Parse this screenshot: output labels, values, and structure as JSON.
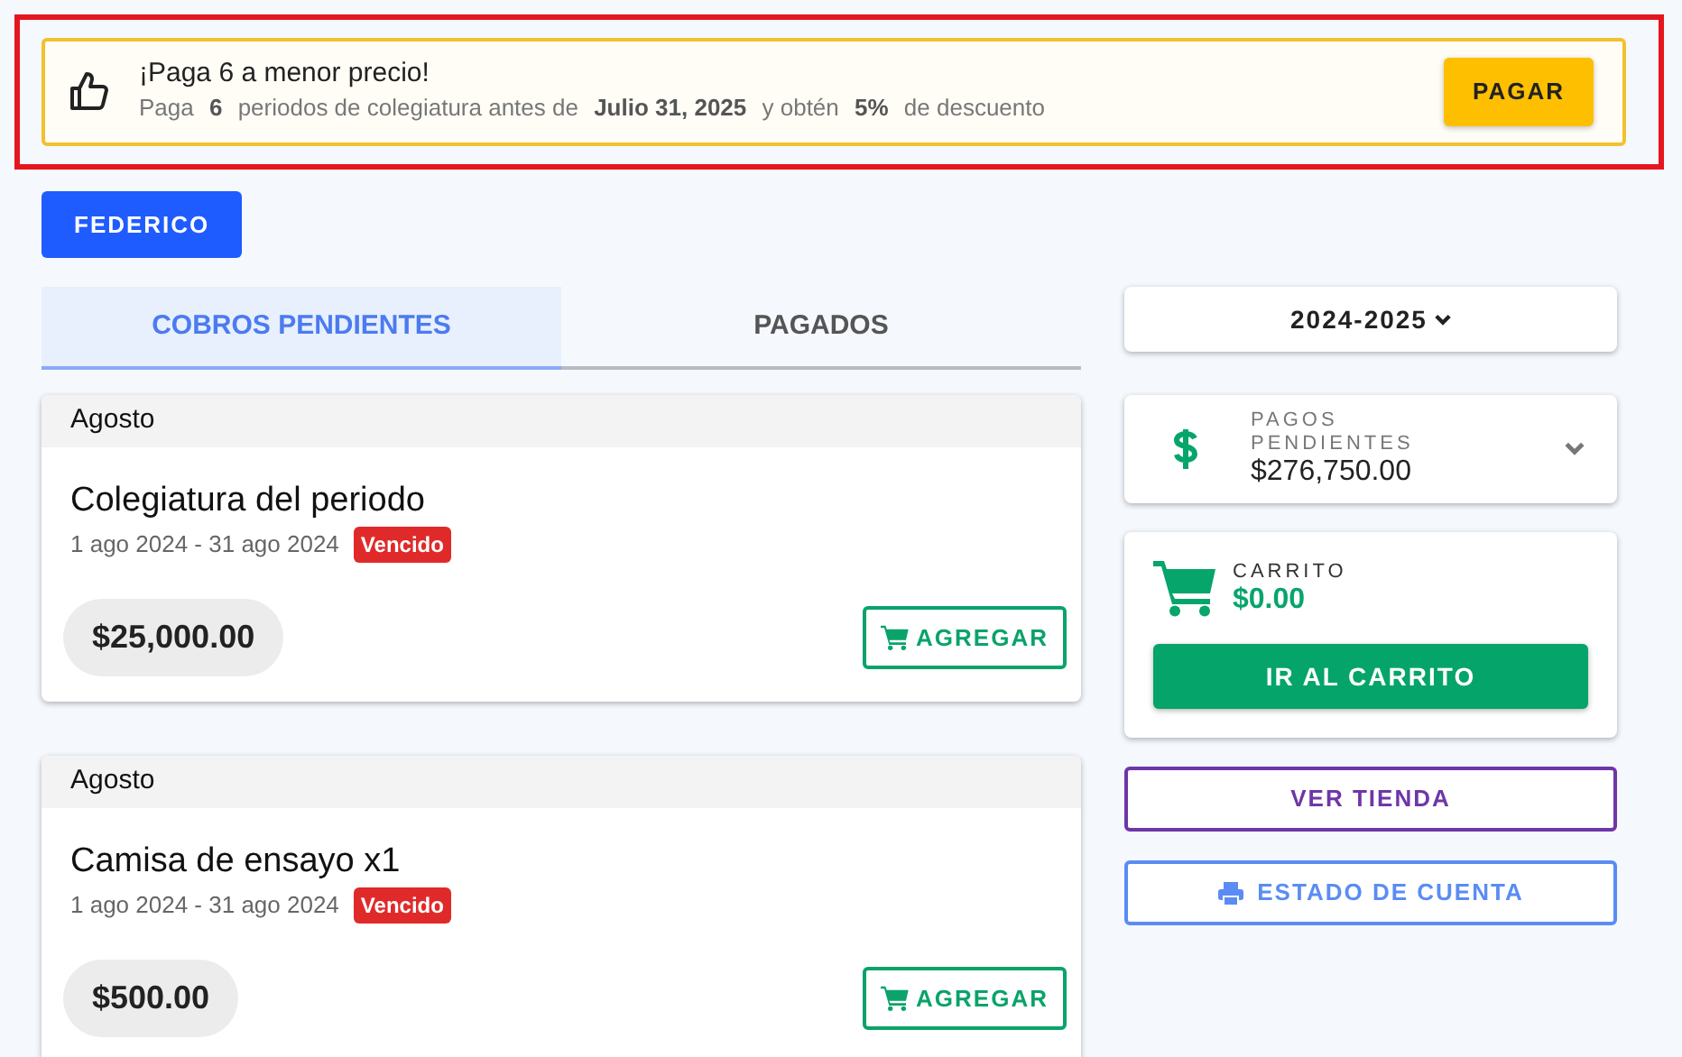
{
  "promo": {
    "title": "¡Paga 6 a menor precio!",
    "message": "Paga **6** periodos de colegiatura antes de **Julio 31, 2025** y obtén **5%** de descuento",
    "button": "PAGAR"
  },
  "student_button": "FEDERICO",
  "tabs": [
    {
      "label": "COBROS PENDIENTES",
      "selected": true
    },
    {
      "label": "PAGADOS",
      "selected": false
    }
  ],
  "charges": [
    {
      "month": "Agosto",
      "title": "Colegiatura del periodo",
      "dates": "1 ago 2024 - 31 ago 2024",
      "status": "Vencido",
      "amount": "$25,000.00",
      "button": "AGREGAR"
    },
    {
      "month": "Agosto",
      "title": "Camisa de ensayo x1",
      "dates": "1 ago 2024 - 31 ago 2024",
      "status": "Vencido",
      "amount": "$500.00",
      "button": "AGREGAR"
    }
  ],
  "school_year": "2024-2025",
  "pending": {
    "label": "PAGOS PENDIENTES",
    "amount": "$276,750.00"
  },
  "cart": {
    "label": "CARRITO",
    "amount": "$0.00",
    "button": "IR AL CARRITO"
  },
  "store_button": "VER TIENDA",
  "statement_button": "ESTADO DE CUENTA"
}
